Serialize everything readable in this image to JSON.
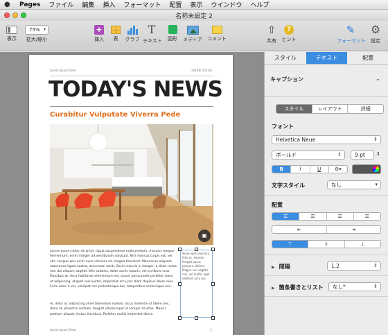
{
  "menubar": {
    "apple": "",
    "items": [
      "Pages",
      "ファイル",
      "編集",
      "挿入",
      "フォーマット",
      "配置",
      "表示",
      "ウインドウ",
      "ヘルプ"
    ]
  },
  "window": {
    "title": "名称未設定 2"
  },
  "toolbar": {
    "view_label": "表示",
    "zoom_value": "75%",
    "zoom_label": "拡大/縮小",
    "insert_label": "挿入",
    "table_label": "表",
    "chart_label": "グラフ",
    "text_label": "テキスト",
    "shape_label": "図形",
    "media_label": "メディア",
    "comment_label": "コメント",
    "share_label": "共有",
    "hint_label": "ヒント",
    "format_label": "フォーマット",
    "settings_label": "設定"
  },
  "document": {
    "header_left": "Lorem Ipsum Dolor",
    "header_right": "2016年10月3日",
    "headline": "TODAY'S NEWS",
    "subhead": "Curabitur Vulputate Viverra Pede",
    "body1": "Lorem ipsum dolor sit amet, ligula suspendisse nulla pretium, rhoncus tempor fermentum, enim integer ad vestibulum volutpat. Nisl rhoncus turpis est, vel elit, congue wisi enim nunc ultricies sit, magna tincidunt. Maecenas aliquam maecenas ligula nostra, accumsan taciti. Sociis mauris in integer, a dolor netus non dui aliquet, sagittis felis sodales, dolor sociis mauris, vel eu libero cras. Faucibus at. Arcu habitasse elementum est, ipsum purus pede porttitor class, ut adipiscing, aliquet sed auctor, imperdiet arcu per diam dapibus libero duis. Enim eros in vel, volutpat nec pellentesque leo, temporibus scelerisque nec.",
    "body2": "Ac dolor ac adipiscing amet bibendum nullam, lacus molestie ut libero nec, diam et, pharetra sodales, feugiat ullamcorper id tempor id vitae. Mauris pretium aliquet, lectus tincidunt. Porttitor mollis imperdiet libero.",
    "sidebox_text": "Nulla eget pharetra felis ac. Aenean feugiat purus posuere ultrices. Magna vel, sagittis nisl, vel mattis eget eleifend arcu leo.",
    "footer_left": "Lorem Ipsum Dolor",
    "footer_right": "1"
  },
  "inspector": {
    "tabs": [
      "スタイル",
      "テキスト",
      "配置"
    ],
    "caption_label": "キャプション",
    "segments": [
      "スタイル",
      "レイアウト",
      "詳細"
    ],
    "font_section": "フォント",
    "font_name": "Helvetica Neue",
    "font_weight": "ボールド",
    "font_size": "9 pt",
    "style_buttons": [
      "B",
      "I",
      "U",
      "⚙▾"
    ],
    "char_style_label": "文字スタイル",
    "char_style_value": "なし",
    "align_section": "配置",
    "spacing_label": "間隔",
    "spacing_value": "1.2",
    "list_label": "箇条書きとリスト",
    "list_value": "なし*"
  },
  "colors": {
    "accent": "#3a8de0",
    "subhead": "#e07020",
    "text_color_swatch": "#555555"
  }
}
